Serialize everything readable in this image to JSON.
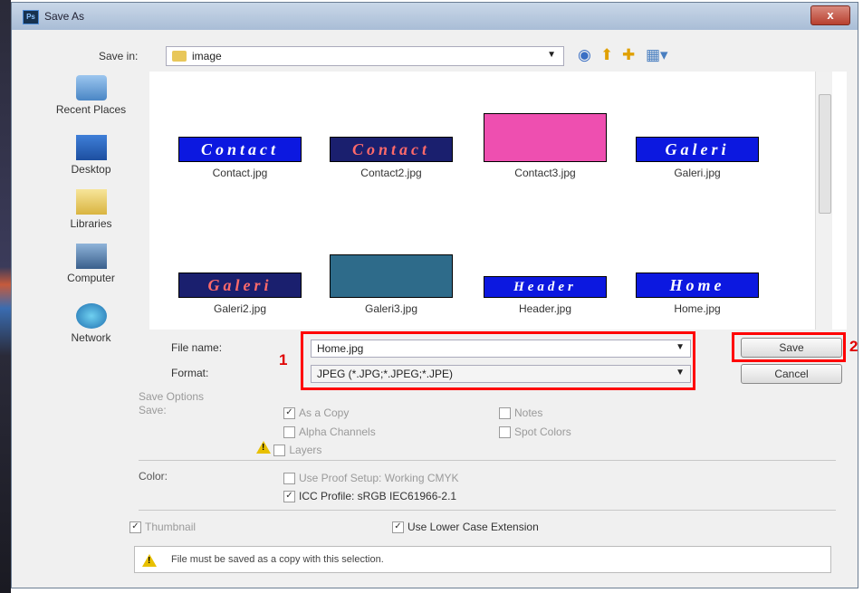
{
  "window": {
    "title": "Save As",
    "app_icon": "Ps",
    "close": "x"
  },
  "save_in": {
    "label": "Save in:",
    "folder": "image"
  },
  "toolbar": {
    "icons": [
      "back-icon",
      "up-folder-icon",
      "new-folder-icon",
      "view-menu-icon"
    ]
  },
  "places": [
    {
      "label": "Recent Places",
      "icon": "recent-places-icon"
    },
    {
      "label": "Desktop",
      "icon": "desktop-icon"
    },
    {
      "label": "Libraries",
      "icon": "libraries-icon"
    },
    {
      "label": "Computer",
      "icon": "computer-icon"
    },
    {
      "label": "Network",
      "icon": "network-icon"
    }
  ],
  "files": [
    {
      "name": "Contact.jpg",
      "thumb_text": "Contact"
    },
    {
      "name": "Contact2.jpg",
      "thumb_text": "Contact"
    },
    {
      "name": "Contact3.jpg",
      "thumb_text": ""
    },
    {
      "name": "Galeri.jpg",
      "thumb_text": "Galeri"
    },
    {
      "name": "Galeri2.jpg",
      "thumb_text": "Galeri"
    },
    {
      "name": "Galeri3.jpg",
      "thumb_text": ""
    },
    {
      "name": "Header.jpg",
      "thumb_text": "Header"
    },
    {
      "name": "Home.jpg",
      "thumb_text": "Home"
    }
  ],
  "file_name": {
    "label": "File name:",
    "value": "Home.jpg"
  },
  "format": {
    "label": "Format:",
    "value": "JPEG (*.JPG;*.JPEG;*.JPE)"
  },
  "buttons": {
    "save": "Save",
    "cancel": "Cancel"
  },
  "annotations": {
    "one": "1",
    "two": "2"
  },
  "save_options": {
    "heading": "Save Options",
    "save_label": "Save:",
    "as_a_copy": "As a Copy",
    "alpha_channels": "Alpha Channels",
    "layers": "Layers",
    "notes": "Notes",
    "spot_colors": "Spot Colors"
  },
  "color": {
    "label": "Color:",
    "use_proof_setup": "Use Proof Setup:  Working CMYK",
    "icc_profile": "ICC Profile:  sRGB IEC61966-2.1"
  },
  "thumbnail": "Thumbnail",
  "lower_case_extension": "Use Lower Case Extension",
  "warning_message": "File must be saved as a copy with this selection."
}
